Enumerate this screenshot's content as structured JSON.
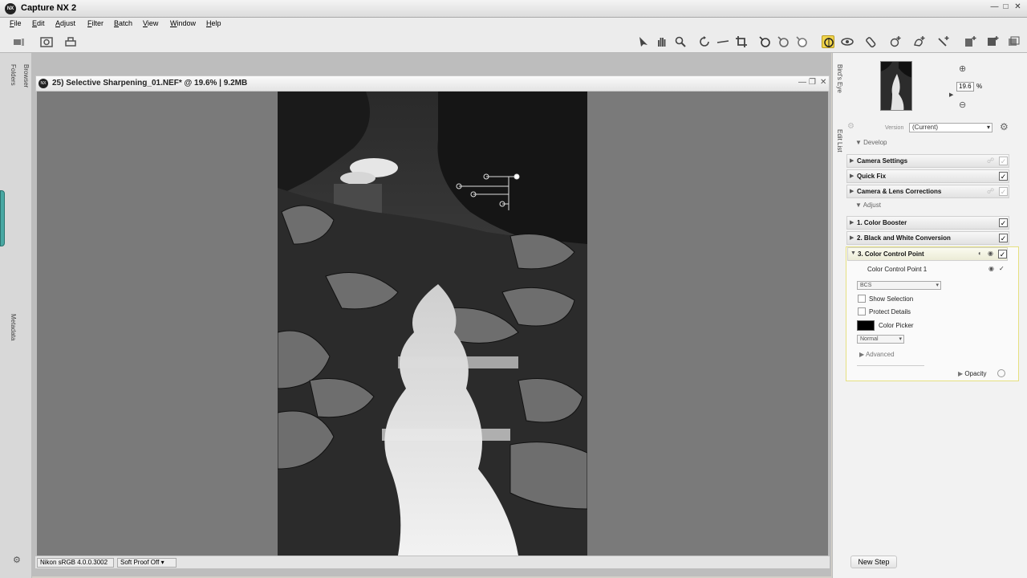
{
  "app": {
    "title": "Capture NX 2",
    "icon_text": "NX"
  },
  "menu": [
    "File",
    "Edit",
    "Adjust",
    "Filter",
    "Batch",
    "View",
    "Window",
    "Help"
  ],
  "left_dock": {
    "folders_tab": "Folders",
    "browser_tab": "Browser",
    "metadata_tab": "Metadata"
  },
  "document": {
    "title": "25) Selective Sharpening_01.NEF* @ 19.6% | 9.2MB"
  },
  "status": {
    "profile": "Nikon sRGB 4.0.0.3002",
    "soft_proof": "Soft Proof Off"
  },
  "birds_eye": {
    "tab": "Bird's Eye",
    "zoom_value": "19.6",
    "zoom_unit": "%"
  },
  "edit_list": {
    "tab": "Edit List",
    "version_label": "Version",
    "version_value": "(Current)",
    "develop_label": "Develop",
    "develop_steps": [
      "Camera Settings",
      "Quick Fix",
      "Camera & Lens Corrections"
    ],
    "adjust_label": "Adjust",
    "adjust_steps": [
      "1. Color Booster",
      "2. Black and White Conversion",
      "3. Color Control Point"
    ],
    "ccp_item": "Color Control Point 1",
    "mode_value": "BCS",
    "show_selection": "Show Selection",
    "protect_details": "Protect Details",
    "color_picker": "Color Picker",
    "blend_value": "Normal",
    "advanced": "Advanced",
    "opacity": "Opacity",
    "new_step": "New Step"
  },
  "colors": {
    "accent_panel_border": "#e6e080",
    "teal_handle": "#49a8a3",
    "canvas_gray": "#7a7a7a"
  }
}
